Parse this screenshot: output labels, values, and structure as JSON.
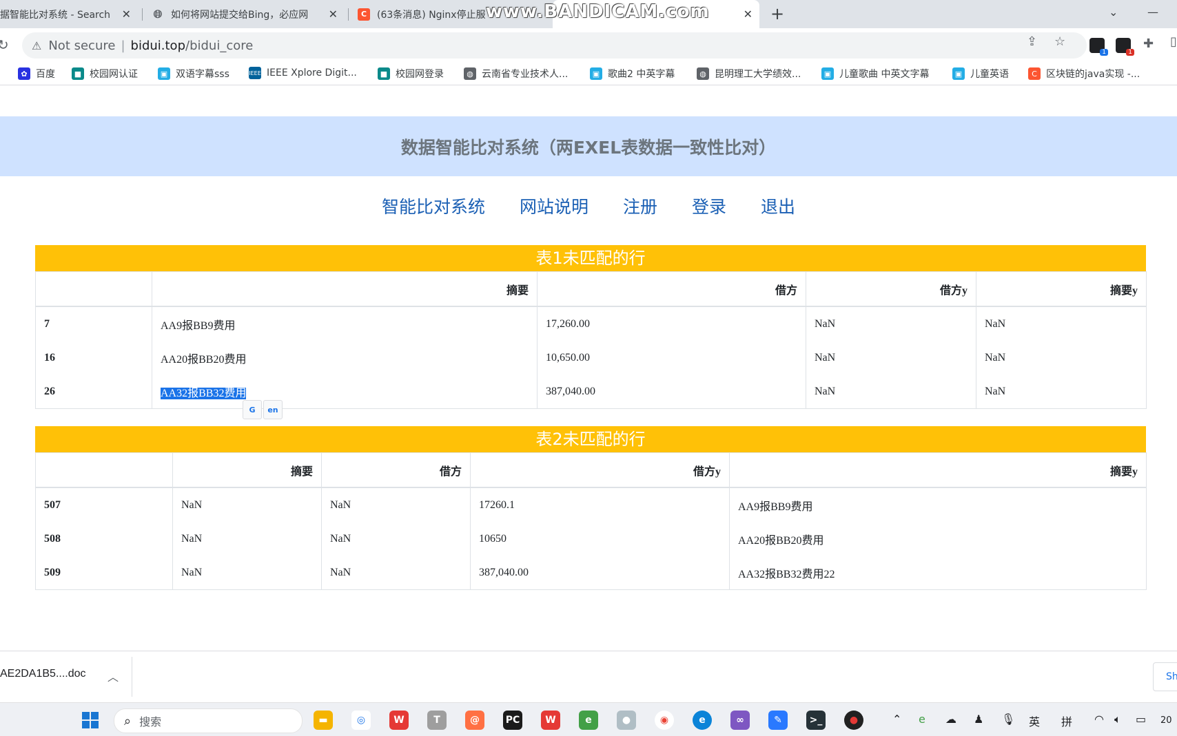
{
  "browser": {
    "tabs": [
      {
        "title": "据智能比对系统 - Search",
        "favicon": "search-tab-icon",
        "active": false
      },
      {
        "title": "如何将网站提交给Bing，必应网",
        "favicon": "globe-icon",
        "active": false
      },
      {
        "title": "(63条消息) Nginx停止服",
        "favicon": "csdn-icon",
        "active": false
      },
      {
        "title": "",
        "favicon": "",
        "active": true
      }
    ],
    "new_tab_label": "+",
    "watermark": "www.BANDICAM.com",
    "security_label": "Not secure",
    "url_host": "bidui.top",
    "url_path": "/bidui_core",
    "bookmarks": [
      {
        "label": "百度",
        "icon": "baidu-icon",
        "color": "#2932e1"
      },
      {
        "label": "校园网认证",
        "icon": "campus-icon",
        "color": "#0a8a8a"
      },
      {
        "label": "双语字幕sss",
        "icon": "bilibili-icon",
        "color": "#23ade5"
      },
      {
        "label": "IEEE Xplore Digit...",
        "icon": "ieee-icon",
        "color": "#00629b"
      },
      {
        "label": "校园网登录",
        "icon": "campus-icon",
        "color": "#0a8a8a"
      },
      {
        "label": "云南省专业技术人...",
        "icon": "globe-icon",
        "color": "#5f6368"
      },
      {
        "label": "歌曲2 中英字幕",
        "icon": "bilibili-icon",
        "color": "#23ade5"
      },
      {
        "label": "昆明理工大学绩效...",
        "icon": "globe-icon",
        "color": "#5f6368"
      },
      {
        "label": "儿童歌曲 中英文字幕",
        "icon": "bilibili-icon",
        "color": "#23ade5"
      },
      {
        "label": "儿童英语",
        "icon": "bilibili-icon",
        "color": "#23ade5"
      },
      {
        "label": "区块链的java实现 -...",
        "icon": "csdn-icon",
        "color": "#fc5531"
      }
    ]
  },
  "page": {
    "title": "数据智能比对系统（两EXEL表数据一致性比对）",
    "nav": [
      "智能比对系统",
      "网站说明",
      "注册",
      "登录",
      "退出"
    ],
    "table1": {
      "caption": "表1未匹配的行",
      "headers": [
        "",
        "摘要",
        "借方",
        "借方y",
        "摘要y"
      ],
      "rows": [
        [
          "7",
          "AA9报BB9费用",
          "17,260.00",
          "NaN",
          "NaN"
        ],
        [
          "16",
          "AA20报BB20费用",
          "10,650.00",
          "NaN",
          "NaN"
        ],
        [
          "26",
          "AA32报BB32费用",
          "387,040.00",
          "NaN",
          "NaN"
        ]
      ]
    },
    "table2": {
      "caption": "表2未匹配的行",
      "headers": [
        "",
        "摘要",
        "借方",
        "借方y",
        "摘要y"
      ],
      "rows": [
        [
          "507",
          "NaN",
          "NaN",
          "17260.1",
          "AA9报BB9费用"
        ],
        [
          "508",
          "NaN",
          "NaN",
          "10650",
          "AA20报BB20费用"
        ],
        [
          "509",
          "NaN",
          "NaN",
          "387,040.00",
          "AA32报BB32费用22"
        ]
      ]
    },
    "translate_popup": {
      "left": "G",
      "right": "en"
    }
  },
  "download": {
    "filename": "AE2DA1B5....doc",
    "show_all": "Sh"
  },
  "taskbar": {
    "search_placeholder": "搜索",
    "ime_lang": "英",
    "ime_mode": "拼",
    "clock_fragment": "20"
  },
  "colors": {
    "header_bg": "#cfe2ff",
    "caption_bg": "#ffc107",
    "nav_link": "#1a5fb4",
    "selection": "#1a73e8"
  }
}
